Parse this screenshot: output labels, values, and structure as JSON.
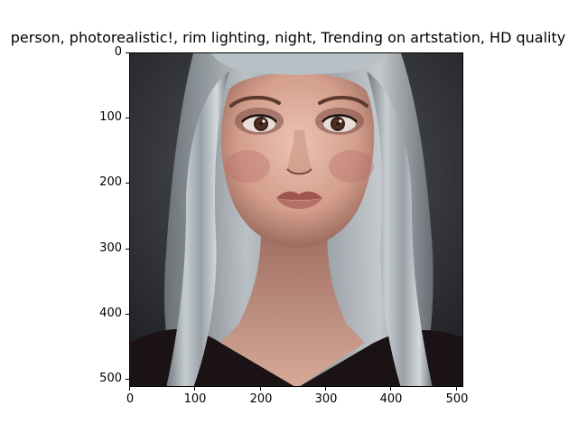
{
  "figure": {
    "title": "person,  photorealistic!, rim lighting, night, Trending on artstation, HD quality"
  },
  "axes": {
    "x_ticks": [
      "0",
      "100",
      "200",
      "300",
      "400",
      "500"
    ],
    "y_ticks": [
      "0",
      "100",
      "200",
      "300",
      "400",
      "500"
    ]
  },
  "image": {
    "subject_colors": {
      "background": "#2c2d31",
      "hair": "#b9c0c5",
      "skin": "#d9a795",
      "lips": "#a8605a",
      "clothing": "#1a1214"
    }
  }
}
